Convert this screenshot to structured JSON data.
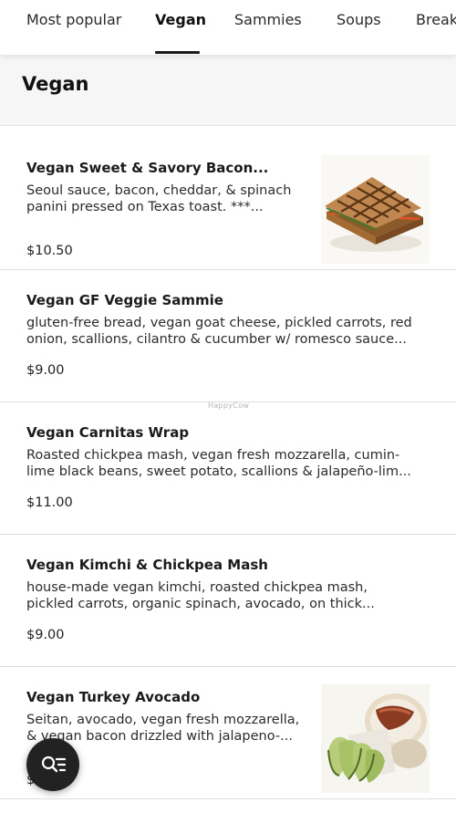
{
  "tabs": [
    {
      "label": "Most popular"
    },
    {
      "label": "Vegan",
      "active": true
    },
    {
      "label": "Sammies"
    },
    {
      "label": "Soups"
    },
    {
      "label": "Break"
    }
  ],
  "section": {
    "title": "Vegan"
  },
  "items": [
    {
      "name": "Vegan Sweet & Savory Bacon...",
      "description": "Seoul sauce, bacon, cheddar, & spinach\npanini pressed on Texas toast. ***...",
      "price": "$10.50",
      "image": "panini-sandwich-photo"
    },
    {
      "name": "Vegan GF Veggie Sammie",
      "description": "gluten-free bread, vegan goat cheese, pickled carrots, red\nonion, scallions, cilantro & cucumber w/ romesco sauce...",
      "price": "$9.00"
    },
    {
      "name": "Vegan Carnitas Wrap",
      "description": "Roasted chickpea mash, vegan fresh mozzarella, cumin-\nlime black beans, sweet potato, scallions & jalapeño-lim...",
      "price": "$11.00"
    },
    {
      "name": "Vegan Kimchi & Chickpea Mash",
      "description": "house-made vegan kimchi, roasted chickpea mash,\npickled carrots, organic spinach, avocado, on thick...",
      "price": "$9.00"
    },
    {
      "name": "Vegan Turkey Avocado",
      "description": "Seitan, avocado, vegan fresh mozzarella,\n& vegan bacon drizzled with jalapeno-...",
      "price": "$",
      "image": "avocado-sandwich-photo"
    }
  ],
  "watermark": "HappyCow",
  "fab": {
    "icon": "search-list-icon"
  },
  "colors": {
    "fab": "#222222",
    "header_bg": "#f6f6f6",
    "divider": "#dedede"
  }
}
